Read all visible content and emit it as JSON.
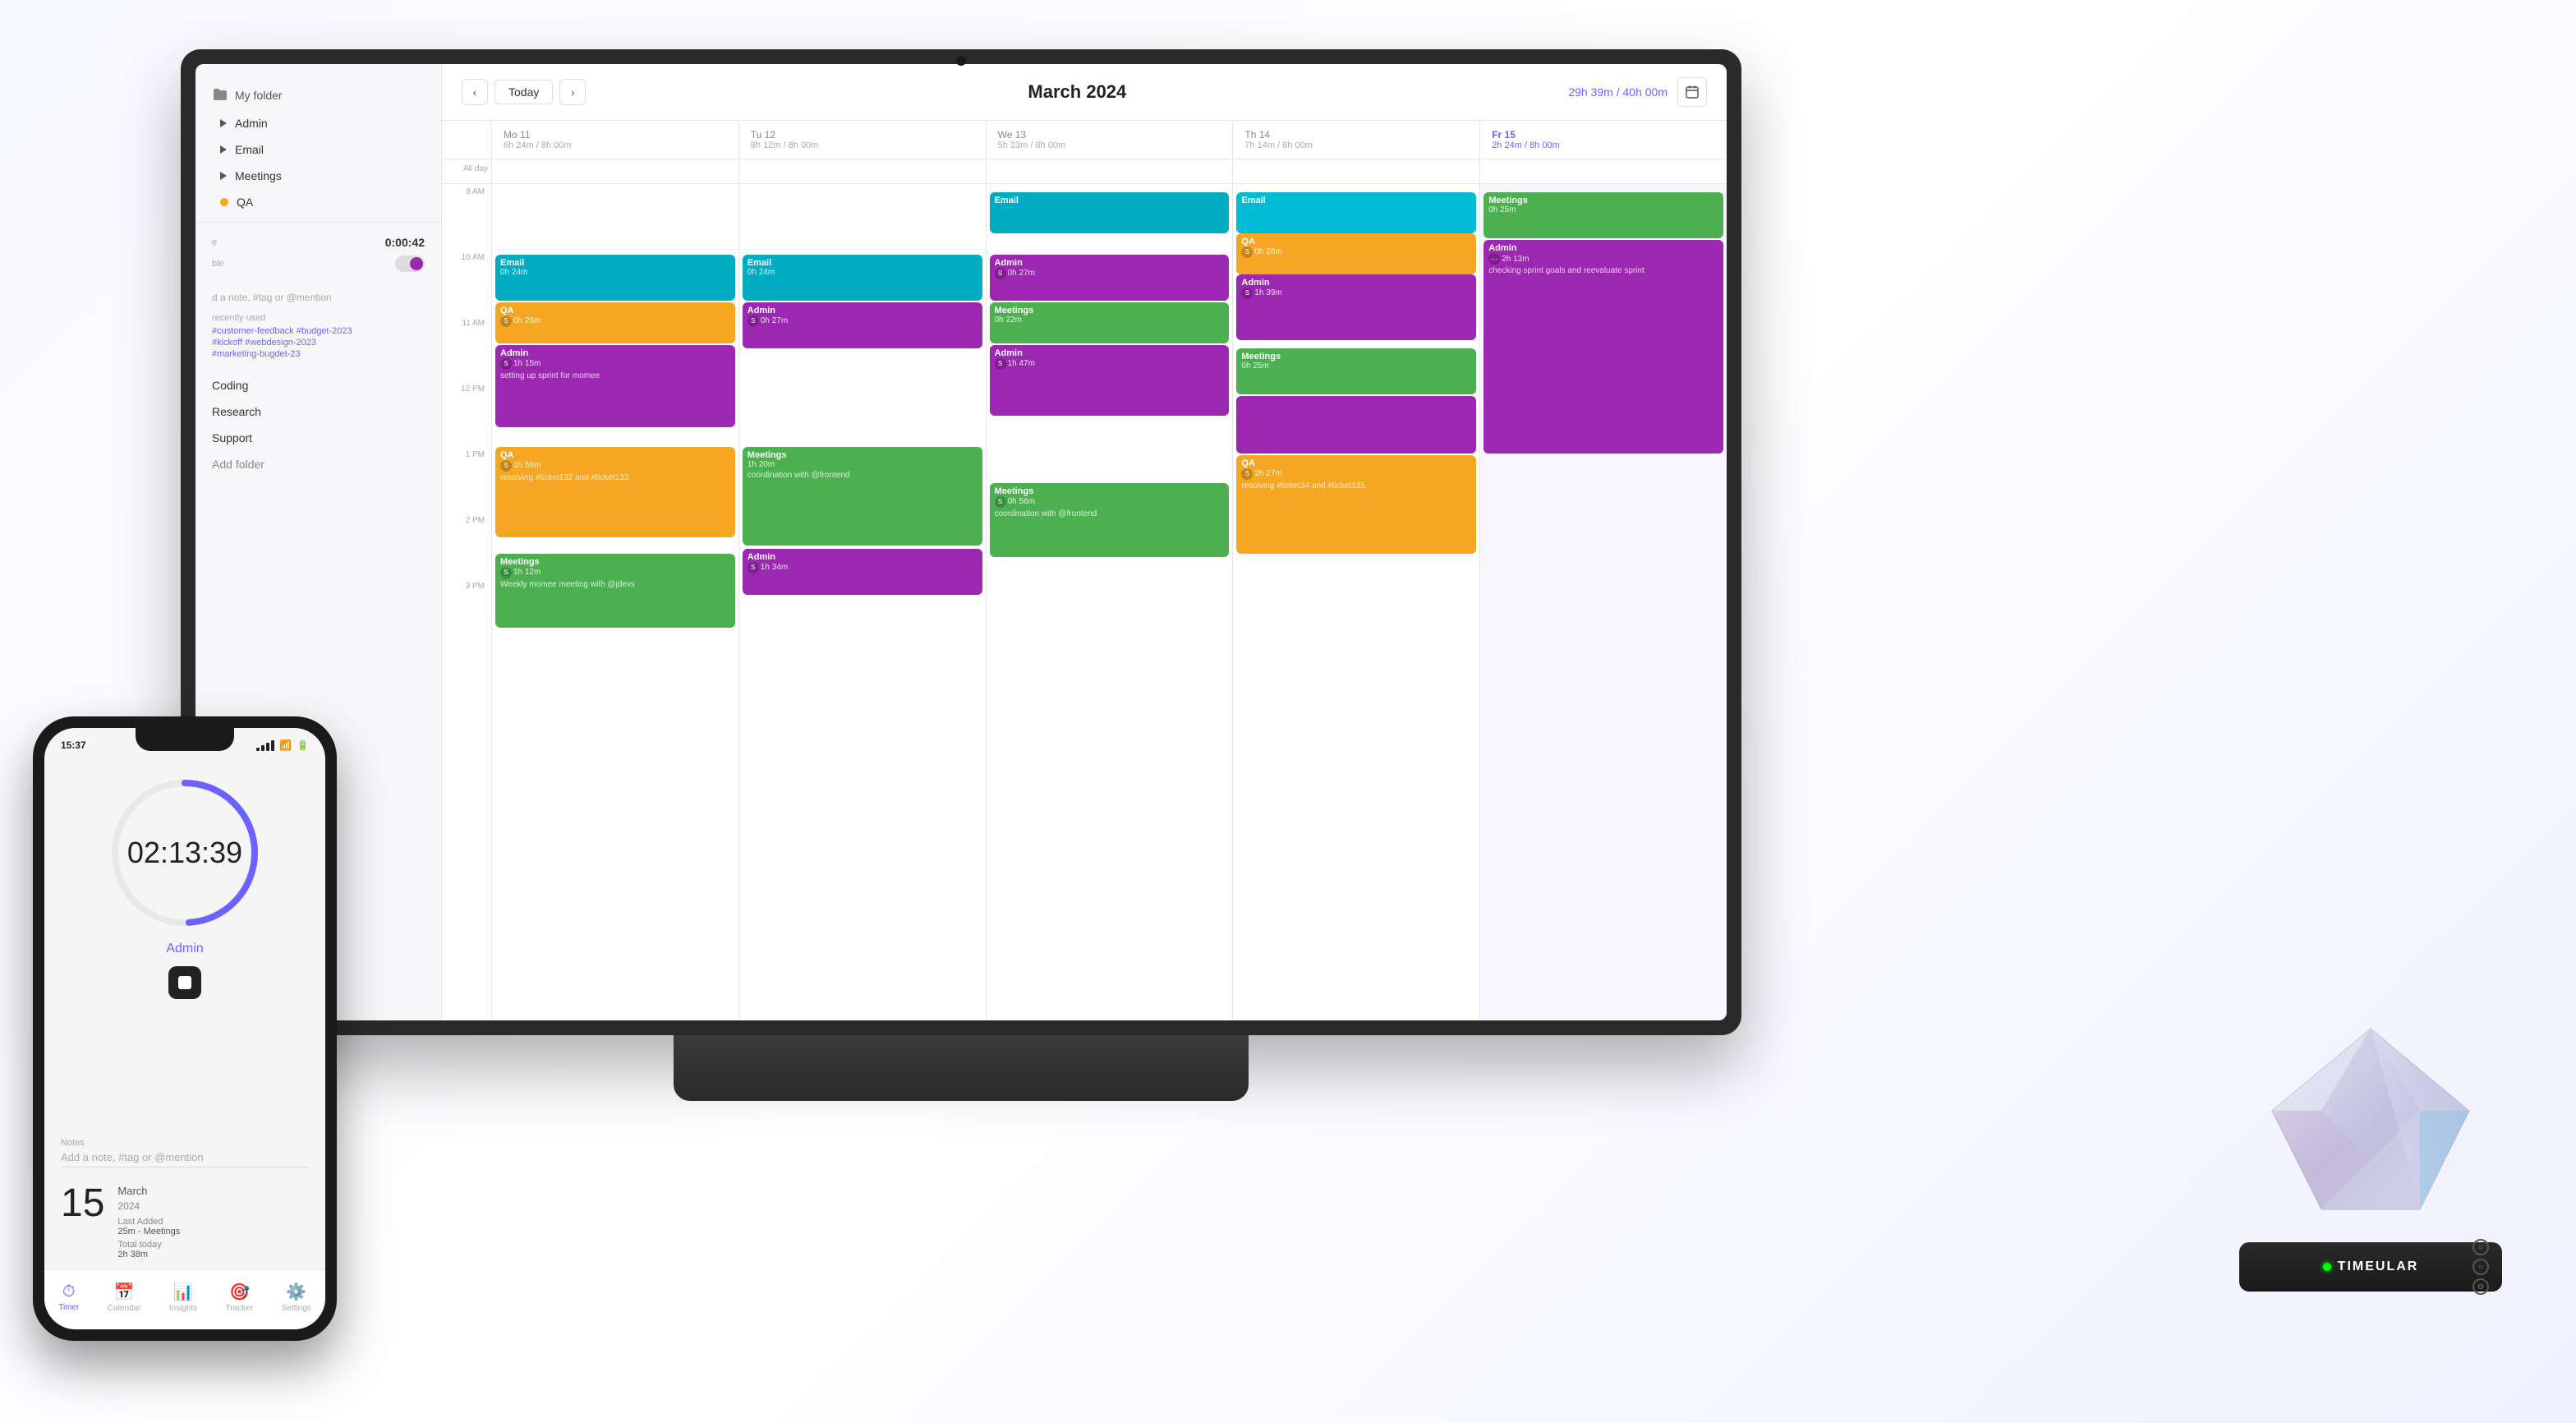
{
  "scene": {
    "background": "#ffffff"
  },
  "laptop": {
    "sidebar": {
      "folder_label": "My folder",
      "items": [
        {
          "label": "Admin",
          "type": "arrow"
        },
        {
          "label": "Email",
          "type": "arrow"
        },
        {
          "label": "Meetings",
          "type": "arrow"
        },
        {
          "label": "QA",
          "type": "dot"
        }
      ],
      "timer_label": "e",
      "timer_value": "0:00:42",
      "toggle_label": "ble",
      "note_placeholder": "d a note, #tag or @mention",
      "recently_used_label": "recently used",
      "tags": [
        "#customer-feedback",
        "#budget-2023",
        "#kickoff",
        "#webdesign-2023",
        "#marketing-bugdet-23"
      ],
      "plain_items": [
        "Coding",
        "Research",
        "Support"
      ],
      "add_folder": "Add folder"
    },
    "calendar": {
      "nav_prev": "‹",
      "nav_today": "Today",
      "nav_next": "›",
      "month_title": "March 2024",
      "time_summary": "29h 39m / 40h 00m",
      "all_day_label": "All day",
      "days": [
        {
          "name": "Mo",
          "date": "11",
          "hours": "6h 24m / 8h 00m",
          "today": false
        },
        {
          "name": "Tu",
          "date": "12",
          "hours": "8h 12m / 8h 00m",
          "today": false
        },
        {
          "name": "We",
          "date": "13",
          "hours": "5h 23m / 8h 00m",
          "today": false
        },
        {
          "name": "Th",
          "date": "14",
          "hours": "7h 14m / 8h 00m",
          "today": false
        },
        {
          "name": "Fr",
          "date": "15",
          "hours": "2h 24m / 8h 00m",
          "today": true
        }
      ],
      "time_slots": [
        "9 AM",
        "10 AM",
        "11 AM",
        "12 PM",
        "1 PM",
        "2 PM",
        "3 PM"
      ]
    }
  },
  "phone": {
    "status_time": "15:37",
    "timer_value": "02:13:39",
    "activity": "Admin",
    "notes_label": "Notes",
    "notes_placeholder": "Add a note, #tag or @mention",
    "date_number": "15",
    "date_month": "March",
    "date_year": "2024",
    "last_added": "Last Added",
    "last_added_value": "25m - Meetings",
    "total_today": "Total today",
    "total_today_value": "2h 38m",
    "nav_items": [
      {
        "label": "Timer",
        "active": true
      },
      {
        "label": "Calendar",
        "active": false
      },
      {
        "label": "Insights",
        "active": false
      },
      {
        "label": "Tracker",
        "active": false
      },
      {
        "label": "Settings",
        "active": false
      }
    ]
  },
  "timeular": {
    "led_color": "#00ff00",
    "brand_name": "TIMEULAR"
  },
  "insights_label": "Insights"
}
